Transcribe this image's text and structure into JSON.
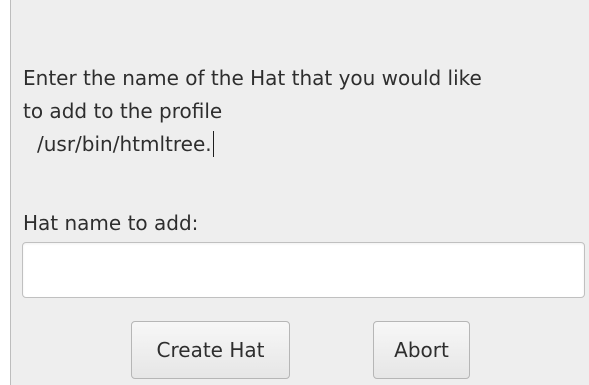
{
  "dialog": {
    "message_line1": "Enter the name of the Hat that you would like",
    "message_line2": "to add to the profile",
    "profile_path": "/usr/bin/htmltree.",
    "field_label": "Hat name to add:",
    "hat_name_value": "",
    "create_button_label": "Create Hat",
    "abort_button_label": "Abort"
  }
}
